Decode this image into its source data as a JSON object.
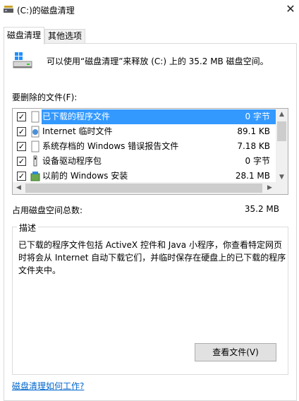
{
  "window": {
    "title": "(C:)的磁盘清理",
    "close_glyph": "✕"
  },
  "tabs": [
    {
      "label": "磁盘清理",
      "active": true
    },
    {
      "label": "其他选项",
      "active": false
    }
  ],
  "summary": {
    "text": "可以使用“磁盘清理”来释放  (C:) 上的 35.2 MB 磁盘空间。"
  },
  "files_label": "要删除的文件(F):",
  "files": [
    {
      "checked": true,
      "icon": "folder-icon",
      "name": "已下载的程序文件",
      "size": "0 字节",
      "selected": true
    },
    {
      "checked": true,
      "icon": "internet-file-icon",
      "name": "Internet 临时文件",
      "size": "89.1 KB",
      "selected": false
    },
    {
      "checked": true,
      "icon": "document-icon",
      "name": "系统存档的 Windows 错误报告文件",
      "size": "7.18 KB",
      "selected": false
    },
    {
      "checked": true,
      "icon": "driver-package-icon",
      "name": "设备驱动程序包",
      "size": "0 字节",
      "selected": false
    },
    {
      "checked": true,
      "icon": "windows-install-icon",
      "name": "以前的 Windows 安装",
      "size": "28.1 MB",
      "selected": false
    }
  ],
  "checkbox_glyph": "✓",
  "total": {
    "label": "占用磁盘空间总数:",
    "value": "35.2 MB"
  },
  "description": {
    "caption": "描述",
    "text": "已下载的程序文件包括 ActiveX 控件和 Java 小程序，你查看特定网页时将会从 Internet 自动下载它们，并临时保存在硬盘上的已下载的程序文件夹中。"
  },
  "view_files_button": "查看文件(V)",
  "help_link": "磁盘清理如何工作?",
  "colors": {
    "selection": "#3399ff",
    "link": "#0066cc"
  }
}
